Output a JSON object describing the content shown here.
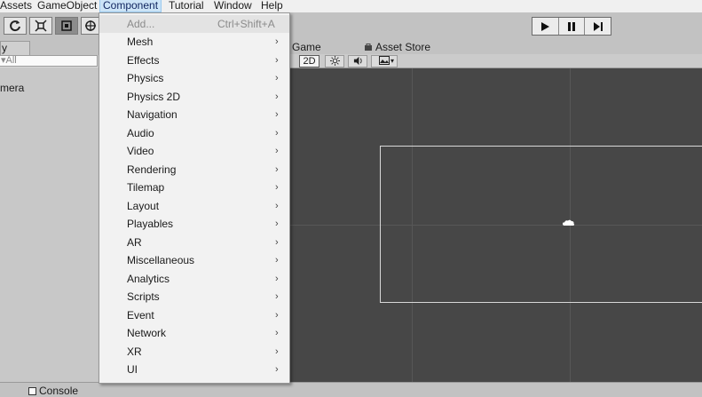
{
  "menubar": {
    "items": [
      "Assets",
      "GameObject",
      "Component",
      "Tutorial",
      "Window",
      "Help"
    ],
    "active": "Component"
  },
  "toolbar": {
    "tools": [
      "rotate-icon",
      "scale-icon",
      "rect-tool-icon",
      "transform-icon"
    ],
    "playback": [
      "play-icon",
      "pause-icon",
      "step-icon"
    ]
  },
  "hierarchy": {
    "tab_label": "y",
    "search_placeholder": "▾All",
    "row": "mera"
  },
  "scene": {
    "tabs": [
      "Game",
      "Asset Store"
    ],
    "mode_2d": "2D",
    "icons": [
      "light-icon",
      "audio-icon",
      "effects-icon"
    ]
  },
  "bottom": {
    "console_label": "Console"
  },
  "component_menu": {
    "add": {
      "label": "Add...",
      "shortcut": "Ctrl+Shift+A"
    },
    "items": [
      "Mesh",
      "Effects",
      "Physics",
      "Physics 2D",
      "Navigation",
      "Audio",
      "Video",
      "Rendering",
      "Tilemap",
      "Layout",
      "Playables",
      "AR",
      "Miscellaneous",
      "Analytics",
      "Scripts",
      "Event",
      "Network",
      "XR",
      "UI"
    ],
    "submenu_arrow": "›"
  }
}
